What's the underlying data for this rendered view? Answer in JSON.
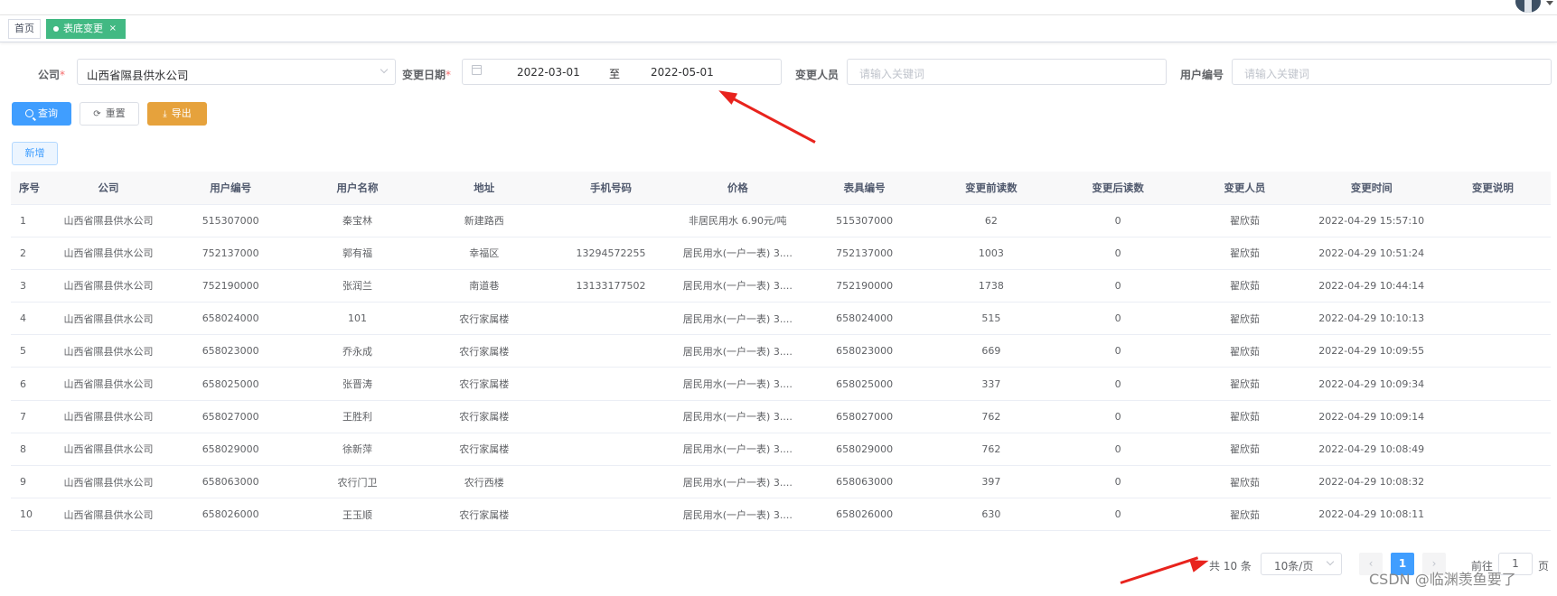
{
  "tags": {
    "home": "首页",
    "active": "表底变更",
    "close": "×"
  },
  "filters": {
    "company_label": "公司",
    "company_value": "山西省隰县供水公司",
    "date_label": "变更日期",
    "date_start": "2022-03-01",
    "date_sep": "至",
    "date_end": "2022-05-01",
    "person_label": "变更人员",
    "person_placeholder": "请输入关键词",
    "userno_label": "用户编号",
    "userno_placeholder": "请输入关键词",
    "required_mark": "*"
  },
  "buttons": {
    "search": "查询",
    "reset": "重置",
    "export": "导出",
    "add": "新增"
  },
  "table": {
    "columns": [
      "序号",
      "公司",
      "用户编号",
      "用户名称",
      "地址",
      "手机号码",
      "价格",
      "表具编号",
      "变更前读数",
      "变更后读数",
      "变更人员",
      "变更时间",
      "变更说明"
    ],
    "rows": [
      [
        "1",
        "山西省隰县供水公司",
        "515307000",
        "秦宝林",
        "新建路西",
        "",
        "非居民用水 6.90元/吨",
        "515307000",
        "62",
        "0",
        "翟欣茹",
        "2022-04-29 15:57:10",
        ""
      ],
      [
        "2",
        "山西省隰县供水公司",
        "752137000",
        "郭有福",
        "幸福区",
        "13294572255",
        "居民用水(一户一表) 3....",
        "752137000",
        "1003",
        "0",
        "翟欣茹",
        "2022-04-29 10:51:24",
        ""
      ],
      [
        "3",
        "山西省隰县供水公司",
        "752190000",
        "张润兰",
        "南道巷",
        "13133177502",
        "居民用水(一户一表) 3....",
        "752190000",
        "1738",
        "0",
        "翟欣茹",
        "2022-04-29 10:44:14",
        ""
      ],
      [
        "4",
        "山西省隰县供水公司",
        "658024000",
        "101",
        "农行家属楼",
        "",
        "居民用水(一户一表) 3....",
        "658024000",
        "515",
        "0",
        "翟欣茹",
        "2022-04-29 10:10:13",
        ""
      ],
      [
        "5",
        "山西省隰县供水公司",
        "658023000",
        "乔永成",
        "农行家属楼",
        "",
        "居民用水(一户一表) 3....",
        "658023000",
        "669",
        "0",
        "翟欣茹",
        "2022-04-29 10:09:55",
        ""
      ],
      [
        "6",
        "山西省隰县供水公司",
        "658025000",
        "张晋涛",
        "农行家属楼",
        "",
        "居民用水(一户一表) 3....",
        "658025000",
        "337",
        "0",
        "翟欣茹",
        "2022-04-29 10:09:34",
        ""
      ],
      [
        "7",
        "山西省隰县供水公司",
        "658027000",
        "王胜利",
        "农行家属楼",
        "",
        "居民用水(一户一表) 3....",
        "658027000",
        "762",
        "0",
        "翟欣茹",
        "2022-04-29 10:09:14",
        ""
      ],
      [
        "8",
        "山西省隰县供水公司",
        "658029000",
        "徐新萍",
        "农行家属楼",
        "",
        "居民用水(一户一表) 3....",
        "658029000",
        "762",
        "0",
        "翟欣茹",
        "2022-04-29 10:08:49",
        ""
      ],
      [
        "9",
        "山西省隰县供水公司",
        "658063000",
        "农行门卫",
        "农行西楼",
        "",
        "居民用水(一户一表) 3....",
        "658063000",
        "397",
        "0",
        "翟欣茹",
        "2022-04-29 10:08:32",
        ""
      ],
      [
        "10",
        "山西省隰县供水公司",
        "658026000",
        "王玉顺",
        "农行家属楼",
        "",
        "居民用水(一户一表) 3....",
        "658026000",
        "630",
        "0",
        "翟欣茹",
        "2022-04-29 10:08:11",
        ""
      ]
    ]
  },
  "pagination": {
    "total": "共 10 条",
    "page_size": "10条/页",
    "prev": "‹",
    "current": "1",
    "next": "›",
    "goto_prefix": "前往",
    "goto_value": "1",
    "goto_suffix": "页"
  },
  "watermark": "CSDN @临渊羡鱼要了",
  "colors": {
    "primary": "#409eff",
    "warning": "#e6a23c",
    "tag_active": "#42b983",
    "arrow": "#e8231d"
  }
}
